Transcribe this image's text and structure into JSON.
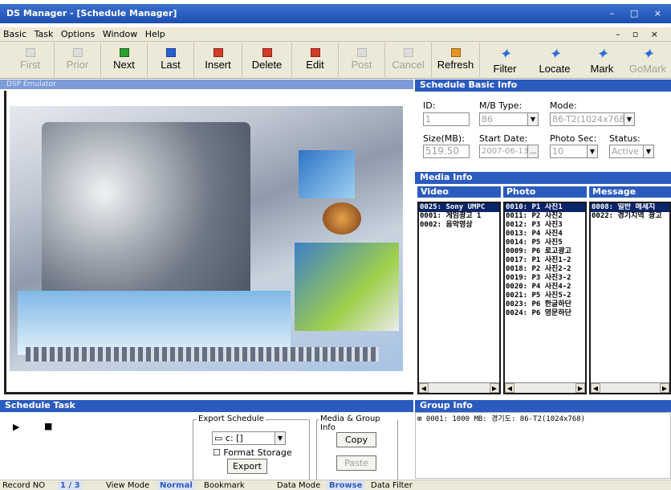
{
  "window": {
    "title": "DS Manager - [Schedule Manager]"
  },
  "menu": [
    "Basic",
    "Task",
    "Options",
    "Window",
    "Help"
  ],
  "toolbar": {
    "first": "First",
    "prior": "Prior",
    "next": "Next",
    "last": "Last",
    "insert": "Insert",
    "delete": "Delete",
    "edit": "Edit",
    "post": "Post",
    "cancel": "Cancel",
    "refresh": "Refresh",
    "filter": "Filter",
    "locate": "Locate",
    "mark": "Mark",
    "gomark": "GoMark"
  },
  "emulator": {
    "title": "DSP Emulator"
  },
  "schedule_basic": {
    "title": "Schedule Basic Info",
    "id_label": "ID:",
    "id": "1",
    "mb_type_label": "M/B Type:",
    "mb_type": "86",
    "mode_label": "Mode:",
    "mode": "86-T2(1024x768)",
    "size_label": "Size(MB):",
    "size": "519.50",
    "start_label": "Start Date:",
    "start": "2007-06-13",
    "photo_sec_label": "Photo Sec:",
    "photo_sec": "10",
    "status_label": "Status:",
    "status": "Active"
  },
  "media_info": {
    "title": "Media Info",
    "video_header": "Video",
    "photo_header": "Photo",
    "message_header": "Message",
    "video": [
      "0025: Sony UMPC",
      "0001: 게임광고 1",
      "0002: 음악영상"
    ],
    "photo": [
      "0010: P1 사진1",
      "0011: P2 사진2",
      "0012: P3 사진3",
      "0013: P4 사진4",
      "0014: P5 사진5",
      "0009: P6 로고광고",
      "0017: P1 사진1-2",
      "0018: P2 사진2-2",
      "0019: P3 사진3-2",
      "0020: P4 사진4-2",
      "0021: P5 사진5-2",
      "0023: P6 한글하단",
      "0024: P6 영문하단"
    ],
    "message": [
      "0008: 일반 메세지",
      "0022: 경기지역 광고"
    ]
  },
  "schedule_task": {
    "title": "Schedule Task",
    "export_group": "Export Schedule",
    "drive": "c: []",
    "format_storage": "Format Storage",
    "export": "Export",
    "media_group": "Media & Group Info",
    "copy": "Copy",
    "paste": "Paste"
  },
  "group_info": {
    "title": "Group Info",
    "line": "0001: 1000 MB: 경기도: 86-T2(1024x768)"
  },
  "status_bar": {
    "record_label": "Record NO",
    "record": "1 / 3",
    "view_label": "View Mode",
    "view": "Normal",
    "bookmark": "Bookmark",
    "data_label": "Data Mode",
    "data": "Browse",
    "filter": "Data Filter"
  }
}
